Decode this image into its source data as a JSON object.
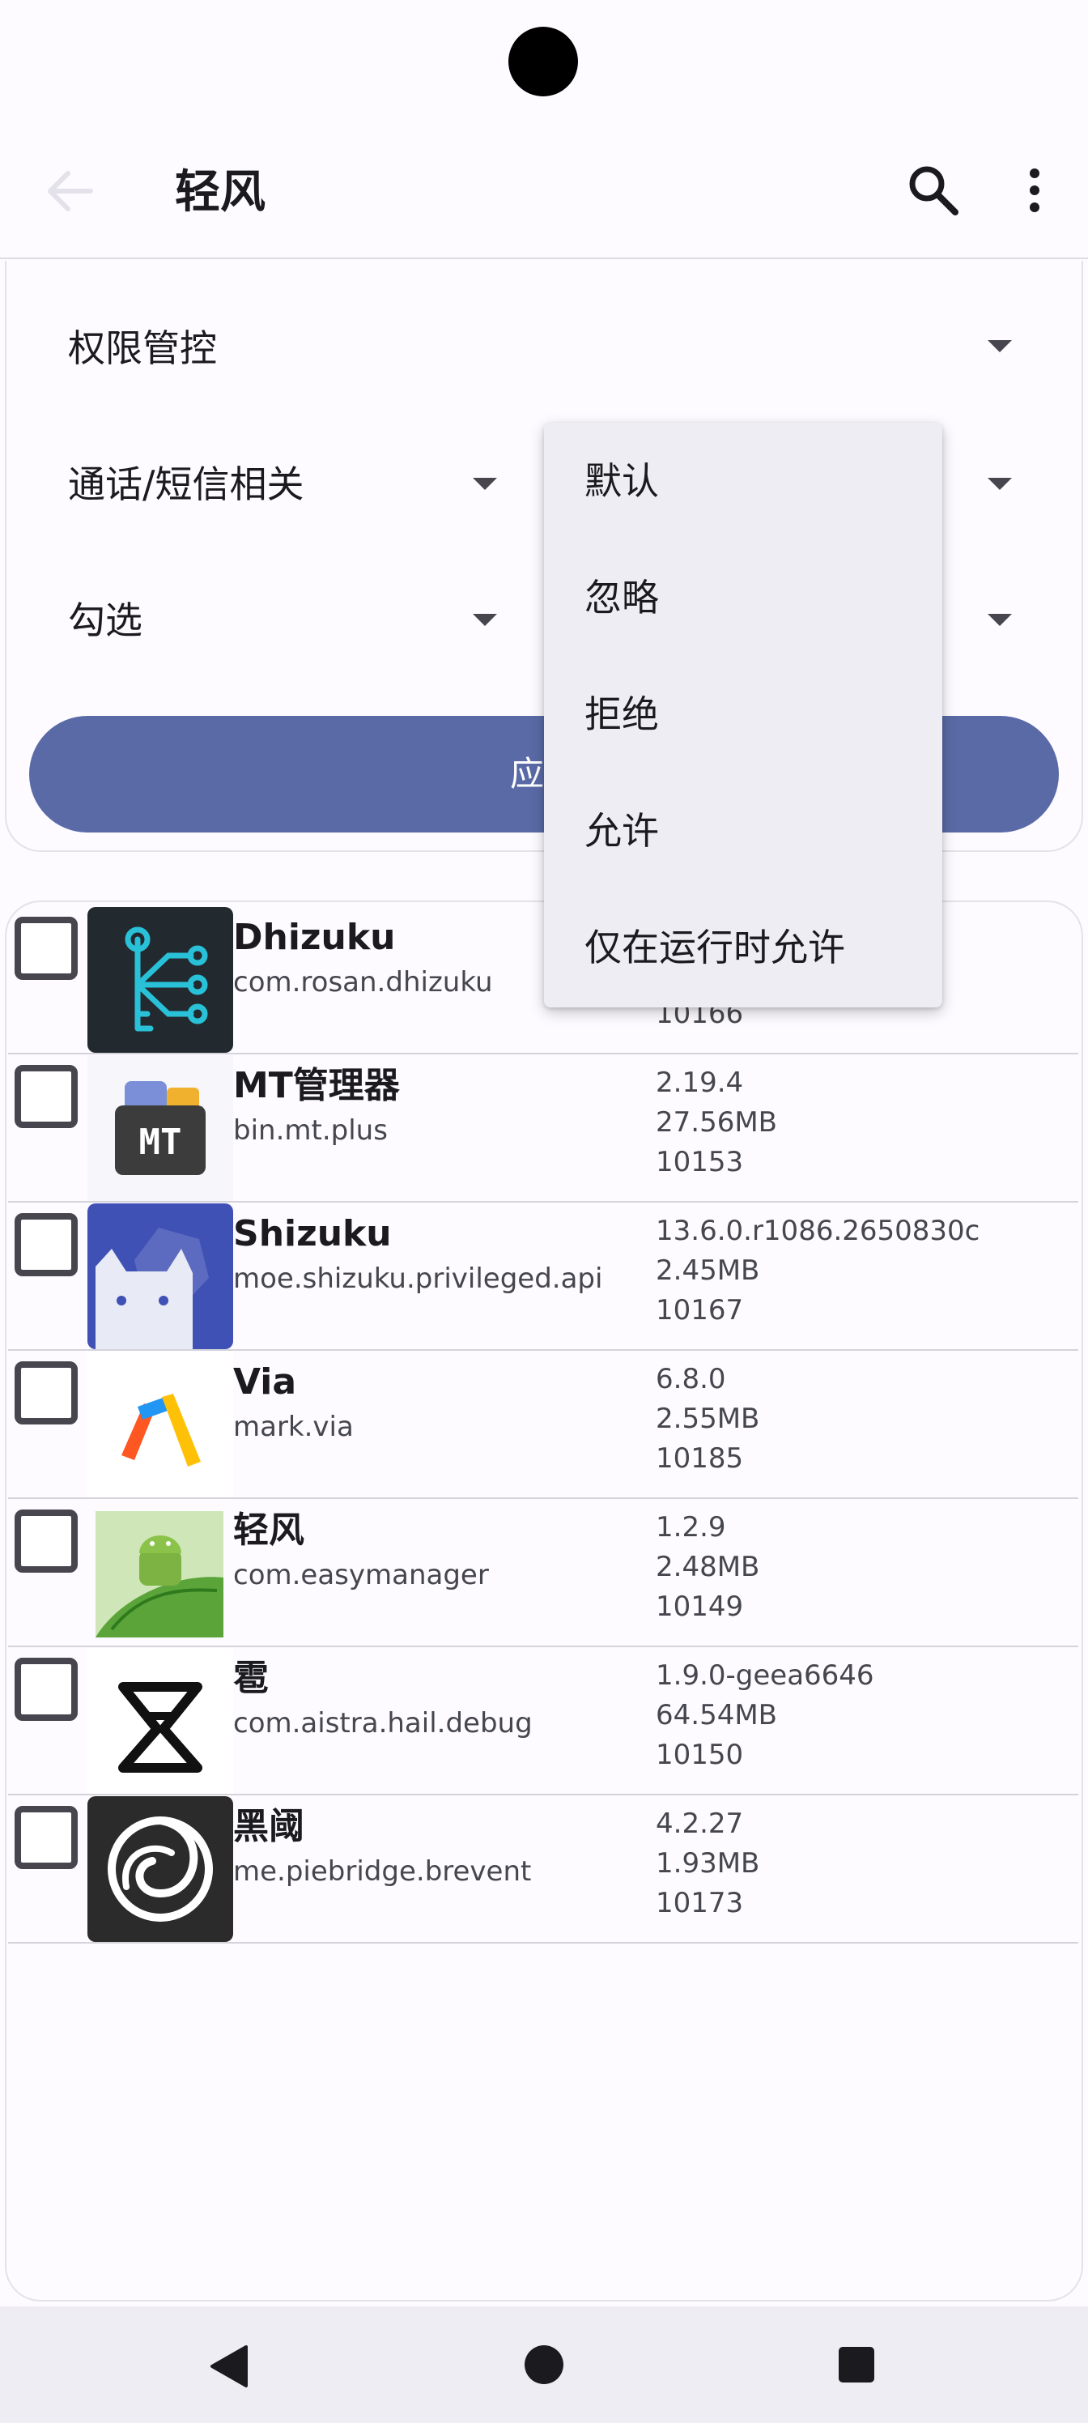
{
  "app_bar": {
    "title": "轻风",
    "back_icon": "arrow-back-icon",
    "search_icon": "search-icon",
    "more_icon": "more-vert-icon"
  },
  "filters": {
    "permission_control": "权限管控",
    "category": "通话/短信相关",
    "selection": "勾选",
    "apply_button": "应用"
  },
  "menu": {
    "items": [
      "默认",
      "忽略",
      "拒绝",
      "允许",
      "仅在运行时允许"
    ]
  },
  "apps": [
    {
      "name": "Dhizuku",
      "package": "com.rosan.dhizuku",
      "version": "",
      "size": "",
      "uid": "10166",
      "icon": "dhizuku-icon"
    },
    {
      "name": "MT管理器",
      "package": "bin.mt.plus",
      "version": "2.19.4",
      "size": "27.56MB",
      "uid": "10153",
      "icon": "mt-manager-icon"
    },
    {
      "name": "Shizuku",
      "package": "moe.shizuku.privileged.api",
      "version": "13.6.0.r1086.2650830c",
      "size": "2.45MB",
      "uid": "10167",
      "icon": "shizuku-icon"
    },
    {
      "name": "Via",
      "package": "mark.via",
      "version": "6.8.0",
      "size": "2.55MB",
      "uid": "10185",
      "icon": "via-icon"
    },
    {
      "name": "轻风",
      "package": "com.easymanager",
      "version": "1.2.9",
      "size": "2.48MB",
      "uid": "10149",
      "icon": "easymanager-icon"
    },
    {
      "name": "雹",
      "package": "com.aistra.hail.debug",
      "version": "1.9.0-geea6646",
      "size": "64.54MB",
      "uid": "10150",
      "icon": "hail-icon"
    },
    {
      "name": "黑阈",
      "package": "me.piebridge.brevent",
      "version": "4.2.27",
      "size": "1.93MB",
      "uid": "10173",
      "icon": "brevent-icon"
    }
  ],
  "nav_bar": {
    "back": "nav-back-icon",
    "home": "nav-home-icon",
    "recents": "nav-recents-icon"
  },
  "colors": {
    "accent": "#5a6aa6",
    "menu_bg": "#efedf4",
    "background": "#fdfbff"
  }
}
